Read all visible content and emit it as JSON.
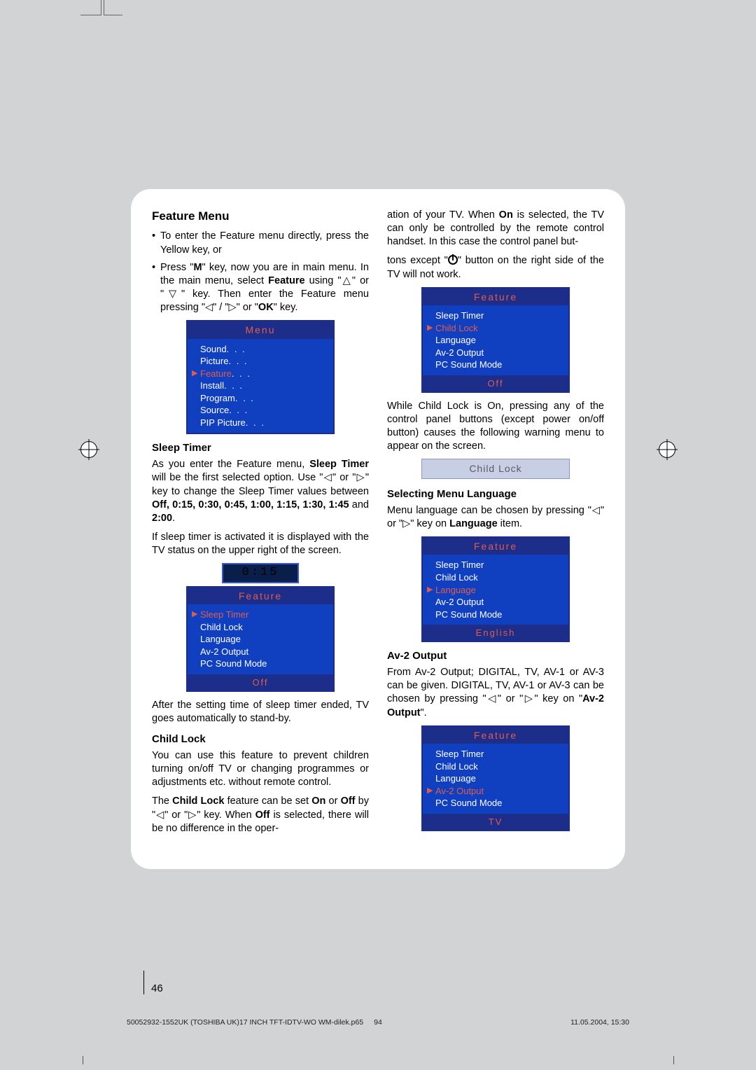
{
  "page_number": "46",
  "footer": {
    "left": "50052932-1552UK (TOSHIBA UK)17 INCH TFT-IDTV-WO WM-dilek.p65",
    "mid": "94",
    "right": "11.05.2004, 15:30"
  },
  "left_col": {
    "h_feature_menu": "Feature Menu",
    "bullet1_a": "To enter the Feature menu directly, press the Yellow key, or",
    "bullet2_a": "Press \"",
    "bullet2_b": "M",
    "bullet2_c": "\" key, now you are in main menu. In the main menu, select ",
    "bullet2_d": "Feature",
    "bullet2_e": " using \"△\" or \"▽\" key. Then enter the Feature menu pressing \"◁\" / \"▷\" or \"",
    "bullet2_f": "OK",
    "bullet2_g": "\" key.",
    "h_sleep": "Sleep Timer",
    "sleep_p1_a": "As you enter the Feature menu, ",
    "sleep_p1_b": "Sleep Timer",
    "sleep_p1_c": " will be the first selected option. Use \"◁\" or \"▷\" key to change the Sleep Timer values between ",
    "sleep_p1_d": "Off, 0:15, 0:30, 0:45, 1:00, 1:15, 1:30, 1:45",
    "sleep_p1_e": " and ",
    "sleep_p1_f": "2:00",
    "sleep_p1_g": ".",
    "sleep_p2": "If sleep timer is activated it is displayed with the TV status on the upper right of the screen.",
    "sleep_p3": "After the setting time of sleep timer ended, TV goes automatically to stand-by.",
    "h_childlock": "Child Lock",
    "cl_p1": "You can use this feature to prevent children turning on/off TV or changing programmes or adjustments etc. without remote control.",
    "cl_p2_a": "The ",
    "cl_p2_b": "Child Lock",
    "cl_p2_c": " feature can be set ",
    "cl_p2_d": "On",
    "cl_p2_e": " or ",
    "cl_p2_f": "Off",
    "cl_p2_g": " by \"◁\" or \"▷\" key. When ",
    "cl_p2_h": "Off",
    "cl_p2_i": " is selected, there will be no difference in the oper-"
  },
  "right_col": {
    "cont_a": "ation of your TV. When ",
    "cont_b": "On",
    "cont_c": " is selected, the TV can only be controlled by the remote control handset. In this case the control panel but-",
    "cont2_a": "tons except \"",
    "cont2_b": "\" button on the right side of the TV will not work.",
    "cl_warn": "While Child Lock is On, pressing any of the control panel buttons (except power on/off button) causes the following warning menu to appear on the screen.",
    "childlock_bar": "Child Lock",
    "h_lang": "Selecting Menu Language",
    "lang_p_a": "Menu language can be chosen by pressing \"◁\" or \"▷\" key on ",
    "lang_p_b": "Language",
    "lang_p_c": " item.",
    "h_av2": "Av-2 Output",
    "av2_p_a": "From Av-2 Output; DIGITAL, TV, AV-1 or AV-3 can be given. DIGITAL, TV, AV-1 or AV-3 can be chosen by pressing \"◁\" or \"▷\" key on \"",
    "av2_p_b": "Av-2 Output",
    "av2_p_c": "\"."
  },
  "osd_menu": {
    "title": "Menu",
    "items": [
      "Sound",
      "Picture",
      "Feature",
      "Install",
      "Program",
      "Source",
      "PIP Picture"
    ],
    "selected_index": 2
  },
  "osd_feature": {
    "title": "Feature",
    "items": [
      "Sleep Timer",
      "Child Lock",
      "Language",
      "Av-2 Output",
      "PC Sound Mode"
    ]
  },
  "osd_sleep": {
    "timer": "0:15",
    "footer": "Off",
    "selected_index": 0
  },
  "osd_childlock": {
    "footer": "Off",
    "selected_index": 1
  },
  "osd_language": {
    "footer": "English",
    "selected_index": 2
  },
  "osd_av2": {
    "footer": "TV",
    "selected_index": 3
  }
}
